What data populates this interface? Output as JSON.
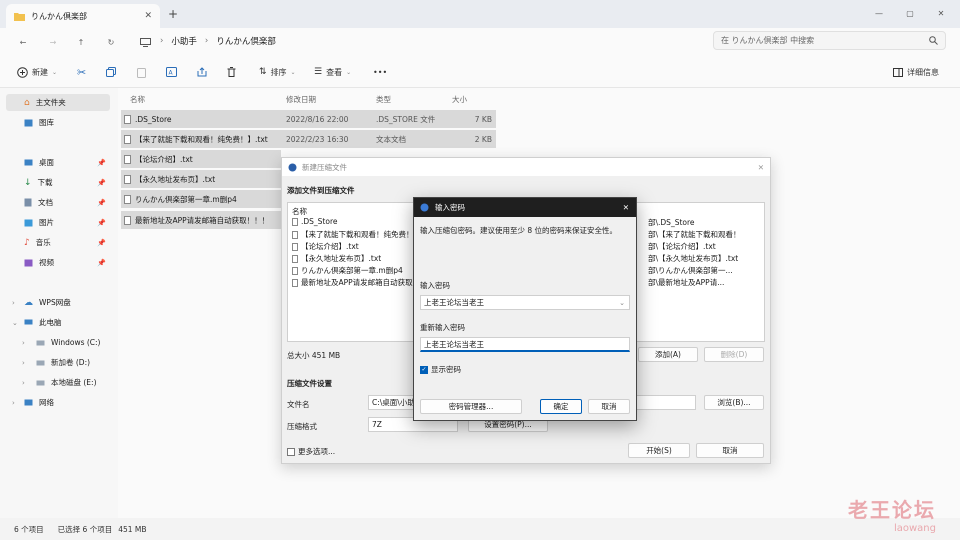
{
  "tab": {
    "title": "りんかん倶楽部"
  },
  "address": {
    "crumbs": [
      "小助手",
      "りんかん倶楽部"
    ],
    "search_placeholder": "在 りんかん倶楽部 中搜索"
  },
  "toolbar": {
    "new_label": "新建",
    "sort_label": "排序",
    "view_label": "查看",
    "more_label": "•••",
    "details_label": "详细信息"
  },
  "sidebar": {
    "items": [
      "主文件夹",
      "图库",
      "桌面",
      "下载",
      "文档",
      "图片",
      "音乐",
      "视频",
      "WPS网盘",
      "此电脑",
      "Windows (C:)",
      "新加卷 (D:)",
      "本地磁盘 (E:)",
      "网络"
    ]
  },
  "columns": {
    "name": "名称",
    "date": "修改日期",
    "type": "类型",
    "size": "大小"
  },
  "files": [
    {
      "name": ".DS_Store",
      "date": "2022/8/16 22:00",
      "type": ".DS_STORE 文件",
      "size": "7 KB"
    },
    {
      "name": "【来了就能下载和观看！纯免费！】.txt",
      "date": "2022/2/23 16:30",
      "type": "文本文档",
      "size": "2 KB"
    },
    {
      "name": "【论坛介绍】.txt",
      "date": "",
      "type": "",
      "size": ""
    },
    {
      "name": "【永久地址发布页】.txt",
      "date": "",
      "type": "",
      "size": ""
    },
    {
      "name": "りんかん倶楽部第一章.m删p4",
      "date": "",
      "type": "",
      "size": ""
    },
    {
      "name": "最新地址及APP请发邮箱自动获取！！！",
      "date": "",
      "type": "",
      "size": ""
    }
  ],
  "status": {
    "count": "6 个项目",
    "selected": "已选择 6 个项目",
    "size": "451 MB"
  },
  "archive_dialog": {
    "title": "新建压缩文件",
    "add_files_label": "添加文件到压缩文件",
    "list_header": "名称",
    "list_items": [
      ".DS_Store",
      "【来了就能下载和观看！纯免费！",
      "【论坛介绍】.txt",
      "【永久地址发布页】.txt",
      "りんかん倶楽部第一章.m删p4",
      "最新地址及APP请发邮箱自动获取"
    ],
    "list_right": [
      "部\\.DS_Store",
      "部\\【来了就能下载和观看！",
      "部\\【论坛介绍】.txt",
      "部\\【永久地址发布页】.txt",
      "部\\りんかん倶楽部第一...",
      "部\\最新地址及APP请..."
    ],
    "total_size": "总大小 451 MB",
    "add_button": "添加(A)",
    "remove_button": "删除(D)",
    "settings_label": "压缩文件设置",
    "filename_label": "文件名",
    "filename_value": "C:\\桌面\\小助",
    "browse_button": "浏览(B)...",
    "format_label": "压缩格式",
    "format_value": "7Z",
    "set_password_button": "设置密码(P)...",
    "more_options": "更多选项...",
    "start_button": "开始(S)",
    "cancel_button": "取消"
  },
  "password_dialog": {
    "title": "输入密码",
    "description": "输入压缩包密码。建议使用至少 8 位的密码来保证安全性。",
    "enter_label": "输入密码",
    "enter_value": "上老王论坛当老王",
    "reenter_label": "重新输入密码",
    "reenter_value": "上老王论坛当老王",
    "show_password_label": "显示密码",
    "manager_button": "密码管理器...",
    "ok_button": "确定",
    "cancel_button": "取消"
  },
  "watermark": {
    "main": "老王论坛",
    "sub": "laowang"
  },
  "colors": {
    "accent": "#005fb8",
    "selection": "#d9d9d9",
    "titlebar_dark": "#1f1f1f"
  }
}
